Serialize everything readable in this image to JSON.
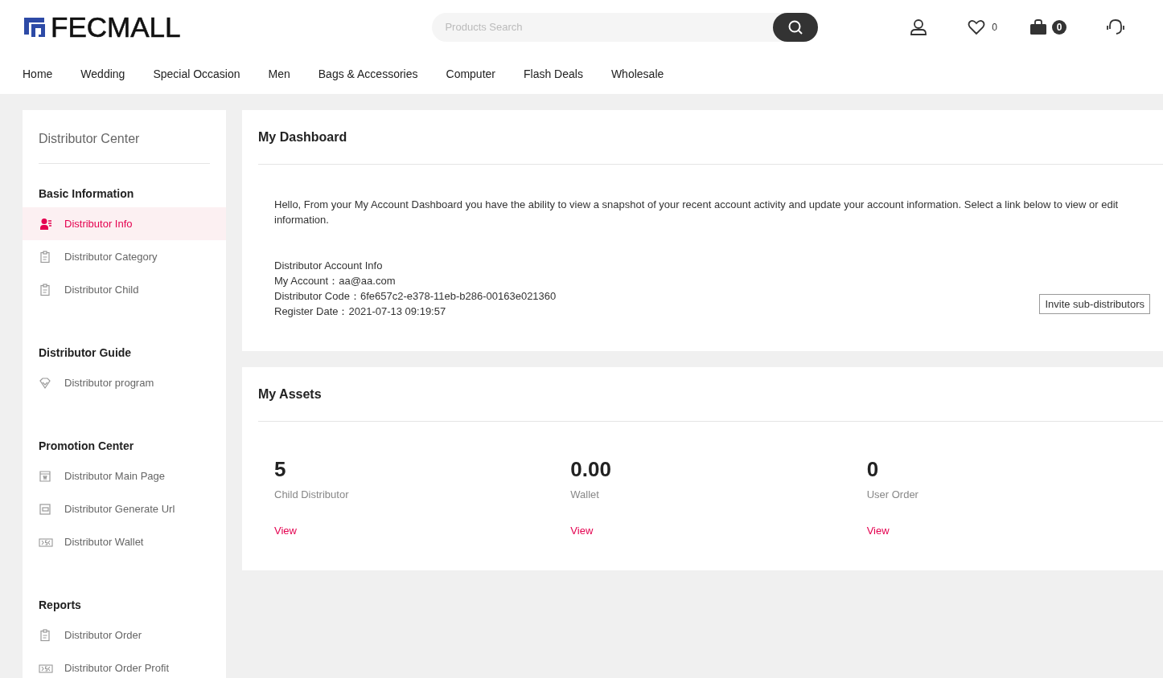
{
  "header": {
    "logo": "FECMALL",
    "search": {
      "placeholder": "Products Search"
    },
    "wishlist_count": "0",
    "cart_count": "0"
  },
  "nav": [
    "Home",
    "Wedding",
    "Special Occasion",
    "Men",
    "Bags & Accessories",
    "Computer",
    "Flash Deals",
    "Wholesale"
  ],
  "sidebar": {
    "title": "Distributor Center",
    "sections": [
      {
        "heading": "Basic Information",
        "items": [
          {
            "label": "Distributor Info",
            "kind": "person",
            "selected": true
          },
          {
            "label": "Distributor Category",
            "kind": "clipboard",
            "selected": false
          },
          {
            "label": "Distributor Child",
            "kind": "clipboard",
            "selected": false
          }
        ]
      },
      {
        "heading": "Distributor Guide",
        "items": [
          {
            "label": "Distributor program",
            "kind": "diamond",
            "selected": false
          }
        ]
      },
      {
        "heading": "Promotion Center",
        "items": [
          {
            "label": "Distributor Main Page",
            "kind": "store",
            "selected": false
          },
          {
            "label": "Distributor Generate Url",
            "kind": "frame",
            "selected": false
          },
          {
            "label": "Distributor Wallet",
            "kind": "money",
            "selected": false
          }
        ]
      },
      {
        "heading": "Reports",
        "items": [
          {
            "label": "Distributor Order",
            "kind": "clipboard",
            "selected": false
          },
          {
            "label": "Distributor Order Profit",
            "kind": "money",
            "selected": false
          }
        ]
      }
    ]
  },
  "dashboard": {
    "title": "My Dashboard",
    "intro_lines": [
      "Hello, From your My Account Dashboard you have the ability to view a snapshot of your recent account activity and update your account information. Select a link below to view or edit",
      "information."
    ],
    "account_heading": "Distributor Account Info",
    "account_fields": [
      {
        "label": "My Account：",
        "value": "aa@aa.com"
      },
      {
        "label": "Distributor Code：",
        "value": "6fe657c2-e378-11eb-b286-00163e021360"
      },
      {
        "label": "Register Date：",
        "value": "2021-07-13 09:19:57"
      }
    ],
    "invite_button": "Invite sub-distributors"
  },
  "assets": {
    "title": "My Assets",
    "items": [
      {
        "value": "5",
        "label": "Child Distributor",
        "link": "View"
      },
      {
        "value": "0.00",
        "label": "Wallet",
        "link": "View"
      },
      {
        "value": "0",
        "label": "User Order",
        "link": "View"
      }
    ]
  }
}
